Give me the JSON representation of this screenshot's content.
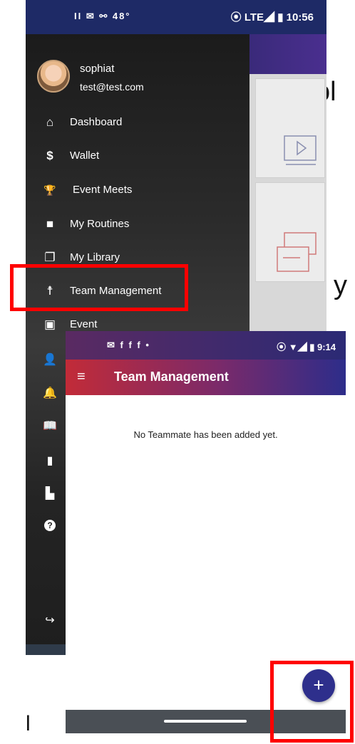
{
  "background_fragments": [
    "ol",
    "y",
    "l"
  ],
  "screen1": {
    "status_left": "II  ✉  ⚯ 48°",
    "status_right": "⦿ LTE◢ ▮ 10:56",
    "drawer": {
      "user_name": "sophiat",
      "user_email": "test@test.com",
      "items": [
        {
          "label": "Dashboard",
          "icon": "home-icon",
          "glyph": "⌂"
        },
        {
          "label": "Wallet",
          "icon": "dollar-icon",
          "glyph": "$"
        },
        {
          "label": "Event Meets",
          "icon": "trophy-icon",
          "glyph": "🏆"
        },
        {
          "label": "My Routines",
          "icon": "video-camera-icon",
          "glyph": "■"
        },
        {
          "label": "My Library",
          "icon": "library-icon",
          "glyph": "❐"
        },
        {
          "label": "Team Management",
          "icon": "person-icon",
          "glyph": "☨"
        },
        {
          "label": "Event",
          "icon": "calendar-icon",
          "glyph": "▣"
        }
      ],
      "icon_only_items": [
        {
          "icon": "account-icon",
          "glyph": "👤"
        },
        {
          "icon": "bell-icon",
          "glyph": "🔔"
        },
        {
          "icon": "book-icon",
          "glyph": "📖"
        },
        {
          "icon": "document-icon",
          "glyph": "▮"
        },
        {
          "icon": "chat-icon",
          "glyph": "▙"
        },
        {
          "icon": "help-icon",
          "glyph": "?"
        },
        {
          "icon": "logout-icon",
          "glyph": "↪"
        }
      ]
    }
  },
  "screen2": {
    "status_left": "✉ f f f •",
    "status_right": "⦿ ▼◢ ▮ 9:14",
    "menu_glyph": "≡",
    "title": "Team Management",
    "empty_message": "No Teammate has been added yet.",
    "fab_glyph": "+"
  },
  "colors": {
    "highlight": "#ff0000",
    "fab": "#2e2f8c",
    "status_bar": "#1e2a66",
    "appbar_start": "#c22b38",
    "appbar_end": "#2d2d8a"
  }
}
